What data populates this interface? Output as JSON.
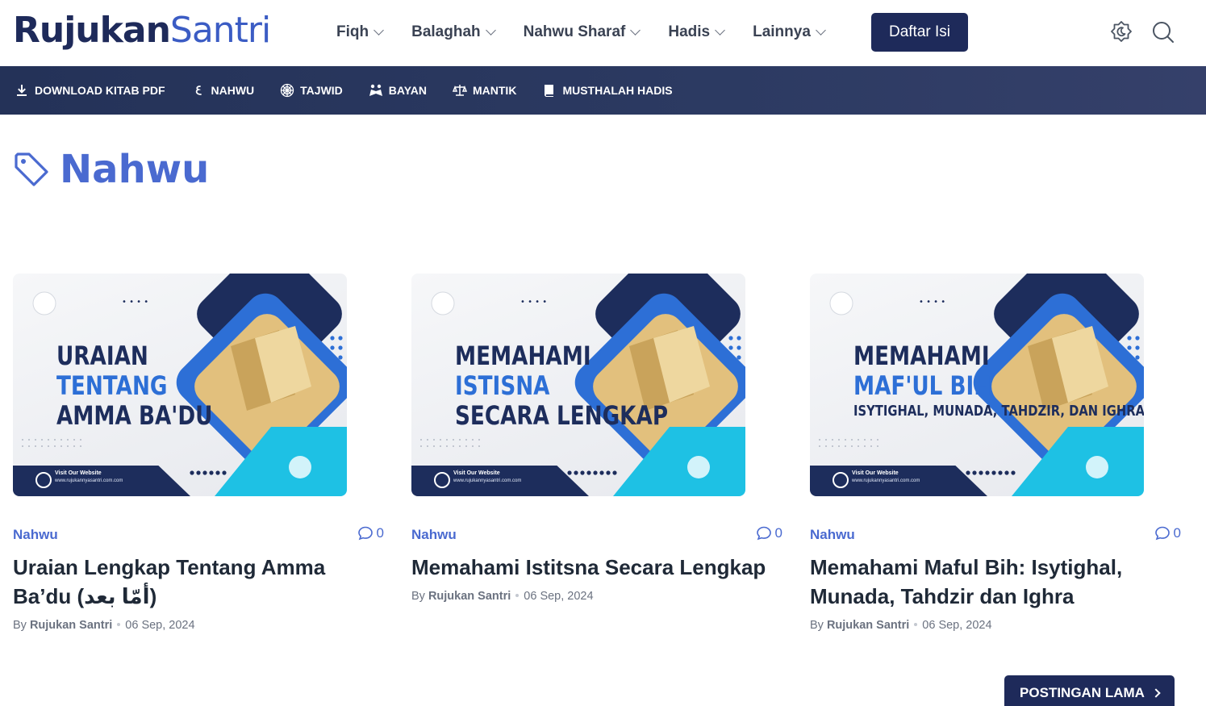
{
  "header": {
    "logo_primary": "Rujukan",
    "logo_secondary": "Santri",
    "nav": [
      {
        "label": "Fiqh"
      },
      {
        "label": "Balaghah"
      },
      {
        "label": "Nahwu Sharaf"
      },
      {
        "label": "Hadis"
      },
      {
        "label": "Lainnya"
      }
    ],
    "cta_label": "Daftar Isi",
    "icons": [
      "theme-toggle-icon",
      "search-icon"
    ]
  },
  "category_bar": [
    {
      "label": "DOWNLOAD KITAB PDF",
      "icon": "download-icon"
    },
    {
      "label": "NAHWU",
      "icon": "arabic-letter-icon"
    },
    {
      "label": "TAJWID",
      "icon": "quran-icon"
    },
    {
      "label": "BAYAN",
      "icon": "reading-people-icon"
    },
    {
      "label": "MANTIK",
      "icon": "scale-icon"
    },
    {
      "label": "MUSTHALAH HADIS",
      "icon": "book-icon"
    }
  ],
  "page": {
    "title": "Nahwu",
    "title_icon": "tag-icon"
  },
  "posts": [
    {
      "thumb_lines": [
        "URAIAN",
        "TENTANG",
        "AMMA BA'DU"
      ],
      "thumb_footer_title": "Visit Our Website",
      "thumb_footer_url": "www.rujukannyasantri.com.com",
      "category": "Nahwu",
      "comment_count": "0",
      "title": "Uraian Lengkap Tentang Amma Ba’du (أمّا بعد)",
      "by": "By",
      "author": "Rujukan Santri",
      "date": "06 Sep, 2024"
    },
    {
      "thumb_lines": [
        "MEMAHAMI",
        "ISTISNA",
        "SECARA LENGKAP"
      ],
      "thumb_footer_title": "Visit Our Website",
      "thumb_footer_url": "www.rujukannyasantri.com.com",
      "category": "Nahwu",
      "comment_count": "0",
      "title": "Memahami Istitsna Secara Lengkap",
      "by": "By",
      "author": "Rujukan Santri",
      "date": "06 Sep, 2024"
    },
    {
      "thumb_lines": [
        "MEMAHAMI",
        "MAF'UL BIH",
        "ISYTIGHAL, MUNADA, TAHDZIR, DAN IGHRA`"
      ],
      "thumb_footer_title": "Visit Our Website",
      "thumb_footer_url": "www.rujukannyasantri.com.com",
      "category": "Nahwu",
      "comment_count": "0",
      "title": "Memahami Maful Bih: Isytighal, Munada, Tahdzir dan Ighra",
      "by": "By",
      "author": "Rujukan Santri",
      "date": "06 Sep, 2024"
    }
  ],
  "pagination": {
    "older_label": "POSTINGAN LAMA"
  },
  "colors": {
    "brand_dark": "#1e2a5a",
    "brand_blue": "#4a6ad0",
    "bar_bg": "#2c3a62"
  }
}
